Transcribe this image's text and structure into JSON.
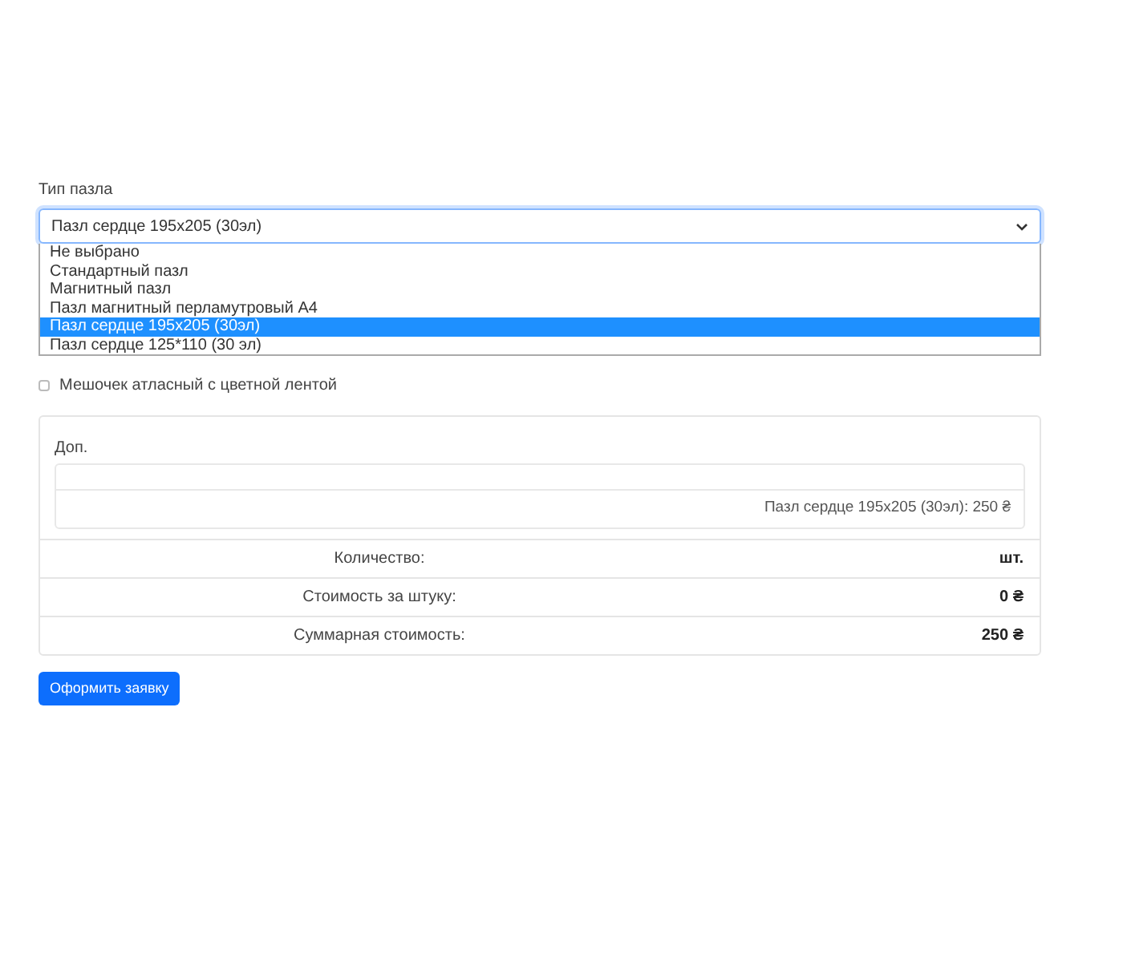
{
  "puzzle_type": {
    "label": "Тип пазла",
    "value": "Пазл сердце 195x205 (30эл)",
    "options": [
      {
        "label": "Не выбрано",
        "selected": false
      },
      {
        "label": "Стандартный пазл",
        "selected": false
      },
      {
        "label": "Магнитный пазл",
        "selected": false
      },
      {
        "label": "Пазл магнитный перламутровый А4",
        "selected": false
      },
      {
        "label": "Пазл сердце 195x205 (30эл)",
        "selected": true
      },
      {
        "label": "Пазл сердце 125*110 (30 эл)",
        "selected": false
      }
    ]
  },
  "extra_option": {
    "label": "Мешочек атласный с цветной лентой",
    "checked": false
  },
  "summary": {
    "extra_label": "Доп.",
    "line_item": "Пазл сердце 195x205 (30эл): 250 ₴",
    "rows": [
      {
        "label": "Количество:",
        "value": "шт."
      },
      {
        "label": "Стоимость за штуку:",
        "value": "0 ₴"
      },
      {
        "label": "Суммарная стоимость:",
        "value": "250 ₴"
      }
    ]
  },
  "submit_button": "Оформить заявку"
}
